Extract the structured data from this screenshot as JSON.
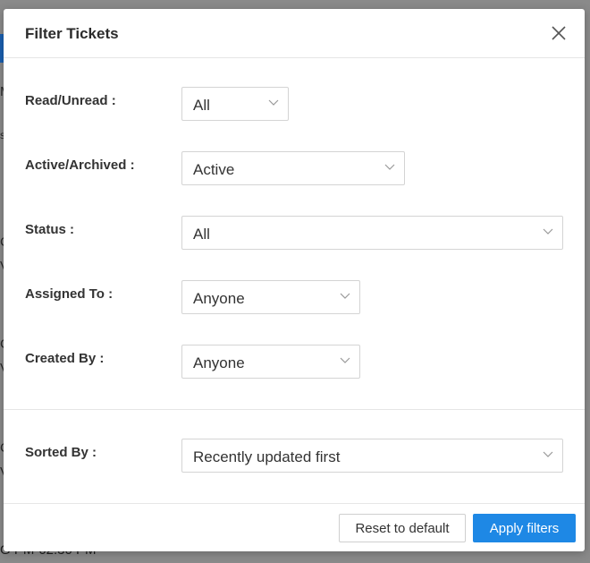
{
  "background": {
    "footer_text": "G PM-02:30 PM",
    "fragments": [
      "M",
      "s",
      "C",
      "V",
      "C",
      "V",
      "C",
      "V"
    ]
  },
  "modal": {
    "title": "Filter Tickets",
    "close_icon": "close-icon"
  },
  "filters": {
    "read_unread": {
      "label": "Read/Unread",
      "colon": ":",
      "value": "All"
    },
    "active_archived": {
      "label": "Active/Archived",
      "colon": ":",
      "value": "Active"
    },
    "status": {
      "label": "Status",
      "colon": ":",
      "value": "All"
    },
    "assigned_to": {
      "label": "Assigned To",
      "colon": ":",
      "value": "Anyone"
    },
    "created_by": {
      "label": "Created By",
      "colon": ":",
      "value": "Anyone"
    },
    "sorted_by": {
      "label": "Sorted By",
      "colon": ":",
      "value": "Recently updated first"
    }
  },
  "footer": {
    "reset_label": "Reset to default",
    "apply_label": "Apply filters"
  },
  "colors": {
    "accent": "#1e88e5",
    "backdrop": "#8a8a8a"
  }
}
